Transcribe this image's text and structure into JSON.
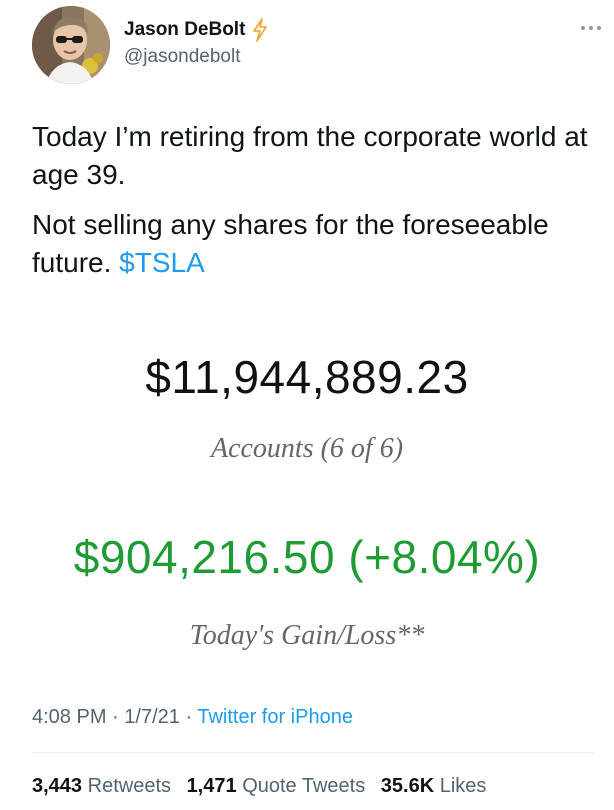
{
  "author": {
    "display_name": "Jason DeBolt",
    "handle": "@jasondebolt",
    "badge_icon": "lightning-bolt-icon",
    "badge_color": "#f4a22d"
  },
  "tweet": {
    "paragraph_1": "Today I’m retiring from the corporate world at age 39.",
    "paragraph_2_text": "Not selling any shares for the foreseeable future.",
    "cashtag": "$TSLA"
  },
  "media": {
    "total_value": "$11,944,889.23",
    "accounts_label": "Accounts (6 of 6)",
    "gain_value": "$904,216.50 (+8.04%)",
    "gain_label": "Today's Gain/Loss**",
    "gain_color": "#1f9b34"
  },
  "meta": {
    "time": "4:08 PM",
    "separator": "·",
    "date": "1/7/21",
    "source": "Twitter for iPhone"
  },
  "stats": {
    "retweets_count": "3,443",
    "retweets_label": "Retweets",
    "quote_count": "1,471",
    "quote_label": "Quote Tweets",
    "likes_count": "35.6K",
    "likes_label": "Likes"
  },
  "colors": {
    "link": "#1d9bf0",
    "secondary_text": "#536471"
  }
}
